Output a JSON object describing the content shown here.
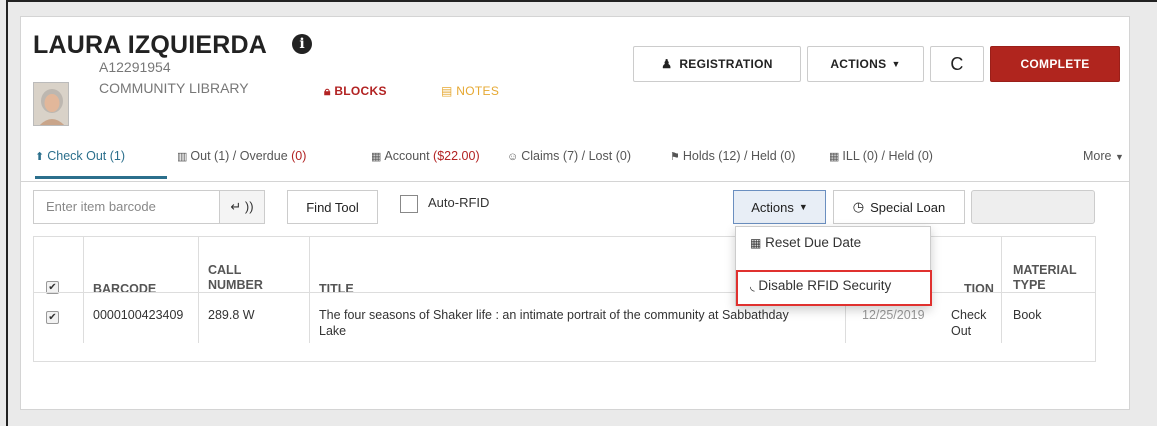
{
  "patron": {
    "name": "LAURA IZQUIERDA",
    "id": "A12291954",
    "library": "COMMUNITY LIBRARY",
    "blocks_label": "BLOCKS",
    "notes_label": "NOTES"
  },
  "header_buttons": {
    "registration": "REGISTRATION",
    "actions": "ACTIONS",
    "refresh": "C",
    "complete": "COMPLETE"
  },
  "tabs": {
    "checkout": "Check Out (1)",
    "out_prefix": "Out (1) / Overdue ",
    "out_red": "(0)",
    "account_prefix": "Account ",
    "account_red": "($22.00)",
    "claims": "Claims (7) / Lost (0)",
    "holds": "Holds (12) / Held (0)",
    "ill": "ILL (0) / Held (0)",
    "more": "More"
  },
  "checkout": {
    "barcode_placeholder": "Enter item barcode",
    "find_tool": "Find Tool",
    "auto_rfid": "Auto-RFID",
    "actions": "Actions",
    "special_loan": "Special Loan"
  },
  "table": {
    "headers": {
      "barcode": "BARCODE",
      "call_1": "CALL",
      "call_2": "NUMBER",
      "title": "TITLE",
      "location_partial": "TION",
      "material_1": "MATERIAL",
      "material_2": "TYPE"
    },
    "row": {
      "barcode": "0000100423409",
      "call_number": "289.8 W",
      "title_1": "The four seasons of Shaker life : an intimate portrait of the community at Sabbathday",
      "title_2": "Lake",
      "date_partial": "12/25/2019",
      "status_1": "Check",
      "status_2": "Out",
      "material_type": "Book"
    }
  },
  "dropdown": {
    "reset_due_date": "Reset Due Date",
    "disable_rfid": "Disable RFID Security"
  },
  "colors": {
    "accent_red": "#b0251e",
    "tab_active": "#2b6f8c",
    "notes": "#e6a832",
    "highlight_border": "#e0312f"
  }
}
